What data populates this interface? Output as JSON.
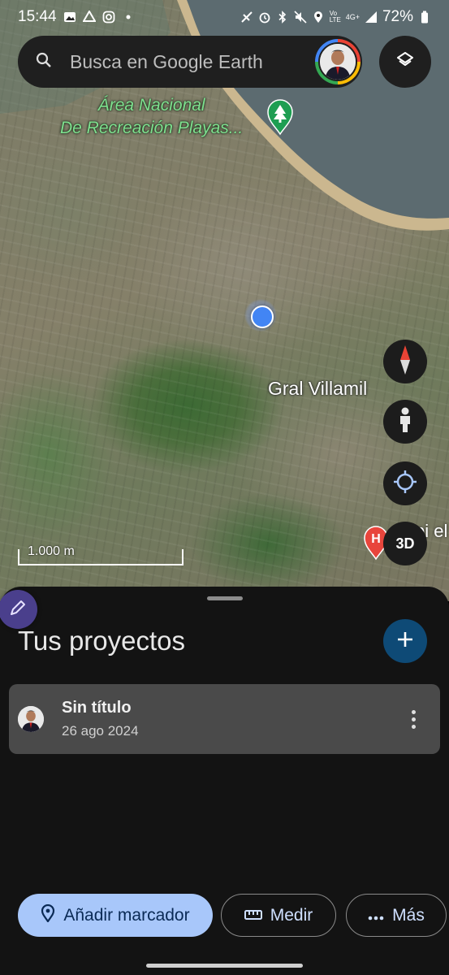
{
  "status_bar": {
    "time": "15:44",
    "network": "4G+",
    "volte": "Vo LTE",
    "battery": "72%"
  },
  "search": {
    "placeholder": "Busca en Google Earth"
  },
  "map": {
    "park_label_line1": "Área Nacional",
    "park_label_line2": "De Recreación Playas...",
    "town_label": "Gral Villamil",
    "hospital_label": "spi el",
    "hospital_marker": "H",
    "scale_label": "1.000 m"
  },
  "controls": {
    "three_d_label": "3D"
  },
  "sheet": {
    "title": "Tus proyectos",
    "projects": [
      {
        "name": "Sin título",
        "date": "26 ago 2024"
      }
    ]
  },
  "actions": {
    "add_marker": "Añadir marcador",
    "measure": "Medir",
    "more": "Más"
  },
  "colors": {
    "accent_chip": "#a8c7fa",
    "fab_blue": "#0e4a76",
    "location_blue": "#4285f4",
    "park_green": "#7ee08e"
  }
}
